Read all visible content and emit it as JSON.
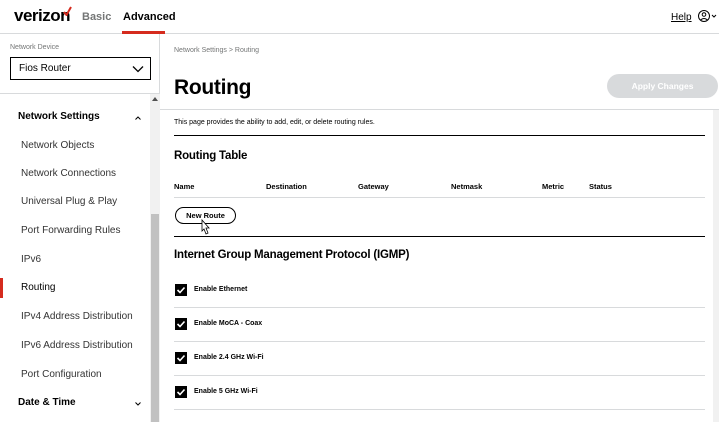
{
  "header": {
    "logo_text": "verizon",
    "tabs": [
      {
        "label": "Basic",
        "active": false
      },
      {
        "label": "Advanced",
        "active": true
      }
    ],
    "help_label": "Help",
    "brand_color": "#d52b1e"
  },
  "sidebar": {
    "device_label": "Network Device",
    "device_value": "Fios Router",
    "sections": [
      {
        "label": "Network Settings",
        "expanded": true,
        "items": [
          {
            "label": "Network Objects"
          },
          {
            "label": "Network Connections"
          },
          {
            "label": "Universal Plug & Play"
          },
          {
            "label": "Port Forwarding Rules"
          },
          {
            "label": "IPv6"
          },
          {
            "label": "Routing",
            "active": true
          },
          {
            "label": "IPv4 Address Distribution"
          },
          {
            "label": "IPv6 Address Distribution"
          },
          {
            "label": "Port Configuration"
          }
        ]
      },
      {
        "label": "Date & Time",
        "expanded": false
      }
    ]
  },
  "main": {
    "breadcrumb": "Network Settings  >  Routing",
    "title": "Routing",
    "apply_label": "Apply Changes",
    "description": "This page provides the ability to add, edit, or delete routing rules.",
    "routing_table": {
      "title": "Routing Table",
      "columns": [
        "Name",
        "Destination",
        "Gateway",
        "Netmask",
        "Metric",
        "Status"
      ],
      "new_route_label": "New Route"
    },
    "igmp": {
      "title": "Internet Group Management Protocol (IGMP)",
      "options": [
        {
          "label": "Enable Ethernet",
          "checked": true
        },
        {
          "label": "Enable MoCA - Coax",
          "checked": true
        },
        {
          "label": "Enable 2.4 GHz Wi-Fi",
          "checked": true
        },
        {
          "label": "Enable 5 GHz Wi-Fi",
          "checked": true
        }
      ]
    }
  }
}
